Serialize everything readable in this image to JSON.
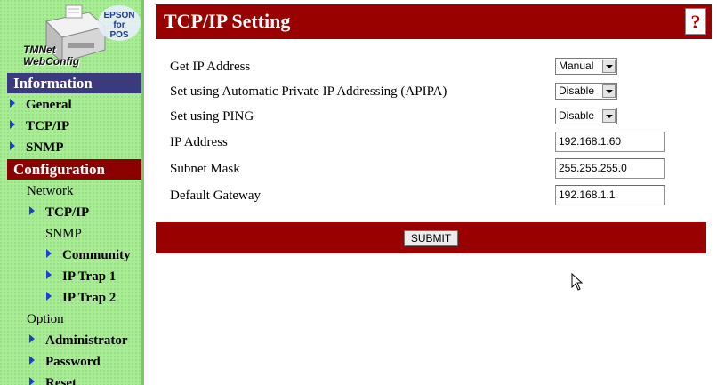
{
  "logo": {
    "brand_line1": "EPSON",
    "brand_line2": "for",
    "brand_line3": "POS",
    "product_line1": "TMNet",
    "product_line2": "WebConfig"
  },
  "sidebar": {
    "information_header": "Information",
    "information_items": [
      {
        "label": "General"
      },
      {
        "label": "TCP/IP"
      },
      {
        "label": "SNMP"
      }
    ],
    "configuration_header": "Configuration",
    "network_label": "Network",
    "network_tcpip": "TCP/IP",
    "snmp_label": "SNMP",
    "snmp_items": [
      {
        "label": "Community"
      },
      {
        "label": "IP Trap 1"
      },
      {
        "label": "IP Trap 2"
      }
    ],
    "option_label": "Option",
    "option_items": [
      {
        "label": "Administrator"
      },
      {
        "label": "Password"
      },
      {
        "label": "Reset"
      }
    ]
  },
  "page": {
    "title": "TCP/IP Setting",
    "help_symbol": "?"
  },
  "form": {
    "get_ip": {
      "label": "Get IP Address",
      "value": "Manual"
    },
    "apipa": {
      "label": "Set using Automatic Private IP Addressing (APIPA)",
      "value": "Disable"
    },
    "ping": {
      "label": "Set using PING",
      "value": "Disable"
    },
    "ip_address": {
      "label": "IP Address",
      "value": "192.168.1.60"
    },
    "subnet_mask": {
      "label": "Subnet Mask",
      "value": "255.255.255.0"
    },
    "default_gateway": {
      "label": "Default Gateway",
      "value": "192.168.1.1"
    },
    "submit_label": "SUBMIT"
  },
  "colors": {
    "sidebar_bg": "#a8ec94",
    "info_header": "#3a3a7c",
    "config_header": "#8b0000",
    "title_bar": "#990000",
    "nav_arrow": "#1c3fd6"
  }
}
